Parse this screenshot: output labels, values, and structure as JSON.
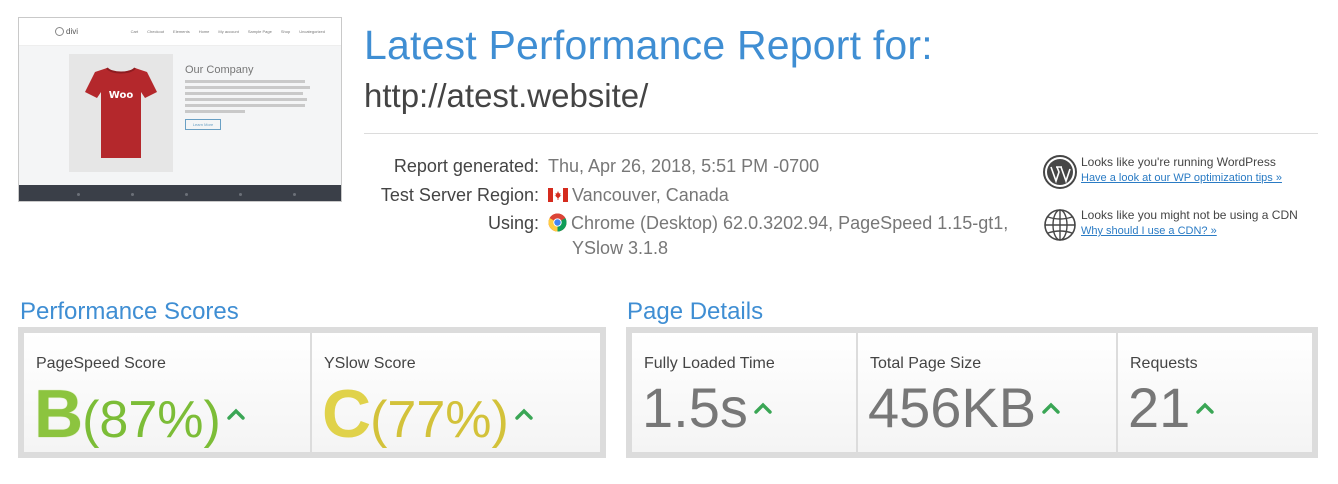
{
  "thumbnail": {
    "logo_text": "divi",
    "nav_links": [
      "Cart",
      "Checkout",
      "Elements",
      "Home",
      "My account",
      "Sample Page",
      "Shop",
      "Uncategorized"
    ],
    "shirt_text": "Woo",
    "company_title": "Our Company",
    "button_label": "Learn More"
  },
  "header": {
    "title": "Latest Performance Report for:",
    "url": "http://atest.website/"
  },
  "report_info": {
    "generated_label": "Report generated:",
    "generated_value": "Thu, Apr 26, 2018, 5:51 PM -0700",
    "region_label": "Test Server Region:",
    "region_value": "Vancouver, Canada",
    "using_label": "Using:",
    "using_value_line1": "Chrome (Desktop) 62.0.3202.94, PageSpeed 1.15-gt1,",
    "using_value_line2": "YSlow 3.1.8"
  },
  "notices": [
    {
      "icon": "wordpress-icon",
      "text": "Looks like you're running WordPress",
      "link": "Have a look at our WP optimization tips »"
    },
    {
      "icon": "globe-icon",
      "text": "Looks like you might not be using a CDN",
      "link": "Why should I use a CDN? »"
    }
  ],
  "performance": {
    "title": "Performance Scores",
    "pagespeed": {
      "label": "PageSpeed Score",
      "grade": "B",
      "percent": "(87%)"
    },
    "yslow": {
      "label": "YSlow Score",
      "grade": "C",
      "percent": "(77%)"
    }
  },
  "page_details": {
    "title": "Page Details",
    "load_time": {
      "label": "Fully Loaded Time",
      "value": "1.5s"
    },
    "page_size": {
      "label": "Total Page Size",
      "value": "456KB"
    },
    "requests": {
      "label": "Requests",
      "value": "21"
    }
  },
  "colors": {
    "accent": "#3f8ed3",
    "grade_b": "#7cbd37",
    "grade_c": "#d3c23a",
    "up_arrow": "#3aa655"
  }
}
